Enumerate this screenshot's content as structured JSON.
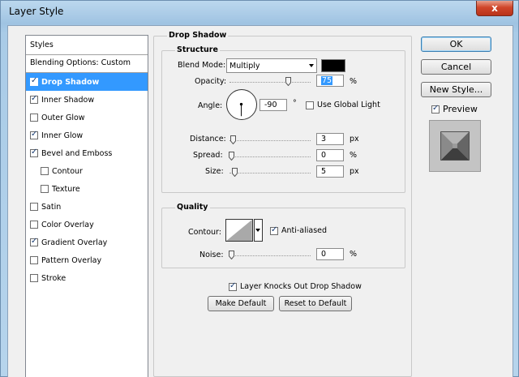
{
  "window": {
    "title": "Layer Style",
    "close_glyph": "x"
  },
  "styles_panel": {
    "header": "Styles",
    "blending_options": "Blending Options: Custom",
    "items": [
      {
        "label": "Drop Shadow",
        "checked": true,
        "selected": true,
        "sub": false
      },
      {
        "label": "Inner Shadow",
        "checked": true,
        "selected": false,
        "sub": false
      },
      {
        "label": "Outer Glow",
        "checked": false,
        "selected": false,
        "sub": false
      },
      {
        "label": "Inner Glow",
        "checked": true,
        "selected": false,
        "sub": false
      },
      {
        "label": "Bevel and Emboss",
        "checked": true,
        "selected": false,
        "sub": false
      },
      {
        "label": "Contour",
        "checked": false,
        "selected": false,
        "sub": true
      },
      {
        "label": "Texture",
        "checked": false,
        "selected": false,
        "sub": true
      },
      {
        "label": "Satin",
        "checked": false,
        "selected": false,
        "sub": false
      },
      {
        "label": "Color Overlay",
        "checked": false,
        "selected": false,
        "sub": false
      },
      {
        "label": "Gradient Overlay",
        "checked": true,
        "selected": false,
        "sub": false
      },
      {
        "label": "Pattern Overlay",
        "checked": false,
        "selected": false,
        "sub": false
      },
      {
        "label": "Stroke",
        "checked": false,
        "selected": false,
        "sub": false
      }
    ]
  },
  "drop_shadow": {
    "title": "Drop Shadow",
    "structure": {
      "title": "Structure",
      "blend_mode_label": "Blend Mode:",
      "blend_mode_value": "Multiply",
      "shadow_color": "#000000",
      "opacity_label": "Opacity:",
      "opacity_value": "75",
      "opacity_unit": "%",
      "angle_label": "Angle:",
      "angle_value": "-90",
      "angle_unit": "°",
      "use_global_light_label": "Use Global Light",
      "use_global_light_checked": false,
      "distance_label": "Distance:",
      "distance_value": "3",
      "distance_unit": "px",
      "spread_label": "Spread:",
      "spread_value": "0",
      "spread_unit": "%",
      "size_label": "Size:",
      "size_value": "5",
      "size_unit": "px"
    },
    "quality": {
      "title": "Quality",
      "contour_label": "Contour:",
      "anti_aliased_label": "Anti-aliased",
      "anti_aliased_checked": true,
      "noise_label": "Noise:",
      "noise_value": "0",
      "noise_unit": "%"
    },
    "knockout_label": "Layer Knocks Out Drop Shadow",
    "knockout_checked": true,
    "make_default_label": "Make Default",
    "reset_default_label": "Reset to Default"
  },
  "buttons": {
    "ok": "OK",
    "cancel": "Cancel",
    "new_style": "New Style...",
    "preview_label": "Preview",
    "preview_checked": true
  },
  "colors": {
    "selection": "#3399ff",
    "close_button": "#c8452a"
  }
}
